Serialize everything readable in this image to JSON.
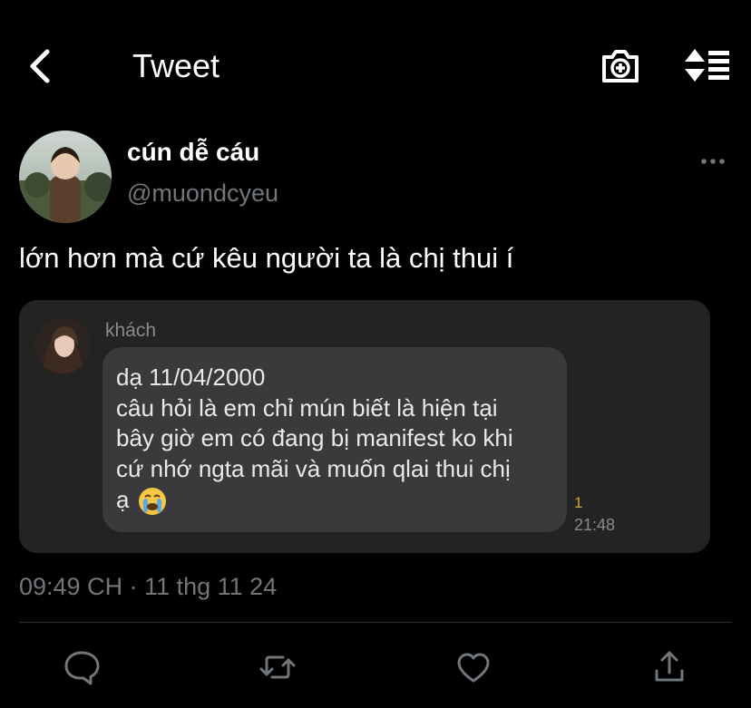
{
  "header": {
    "title": "Tweet",
    "icons": [
      "back-icon",
      "camera-plus-icon",
      "sort-icon"
    ]
  },
  "author": {
    "name": "cún dễ cáu",
    "handle": "@muondcyeu"
  },
  "tweet": {
    "text": "lớn hơn mà cứ kêu người ta là chị thui í",
    "timestamp": "09:49 CH · 11 thg 11 24"
  },
  "media": {
    "chat_name": "khách",
    "message_lines": [
      "dạ 11/04/2000",
      "câu hỏi là em chỉ mún biết là hiện tại",
      "bây giờ em có đang bị manifest ko khi",
      "cứ nhớ ngta mãi và muốn qlai thui chị",
      "ạ"
    ],
    "read_count": "1",
    "time": "21:48"
  },
  "actions": [
    "reply-icon",
    "retweet-icon",
    "like-icon",
    "share-icon"
  ],
  "colors": {
    "background": "#000000",
    "secondary_text": "#71767b",
    "bubble": "#3a3a3c"
  }
}
